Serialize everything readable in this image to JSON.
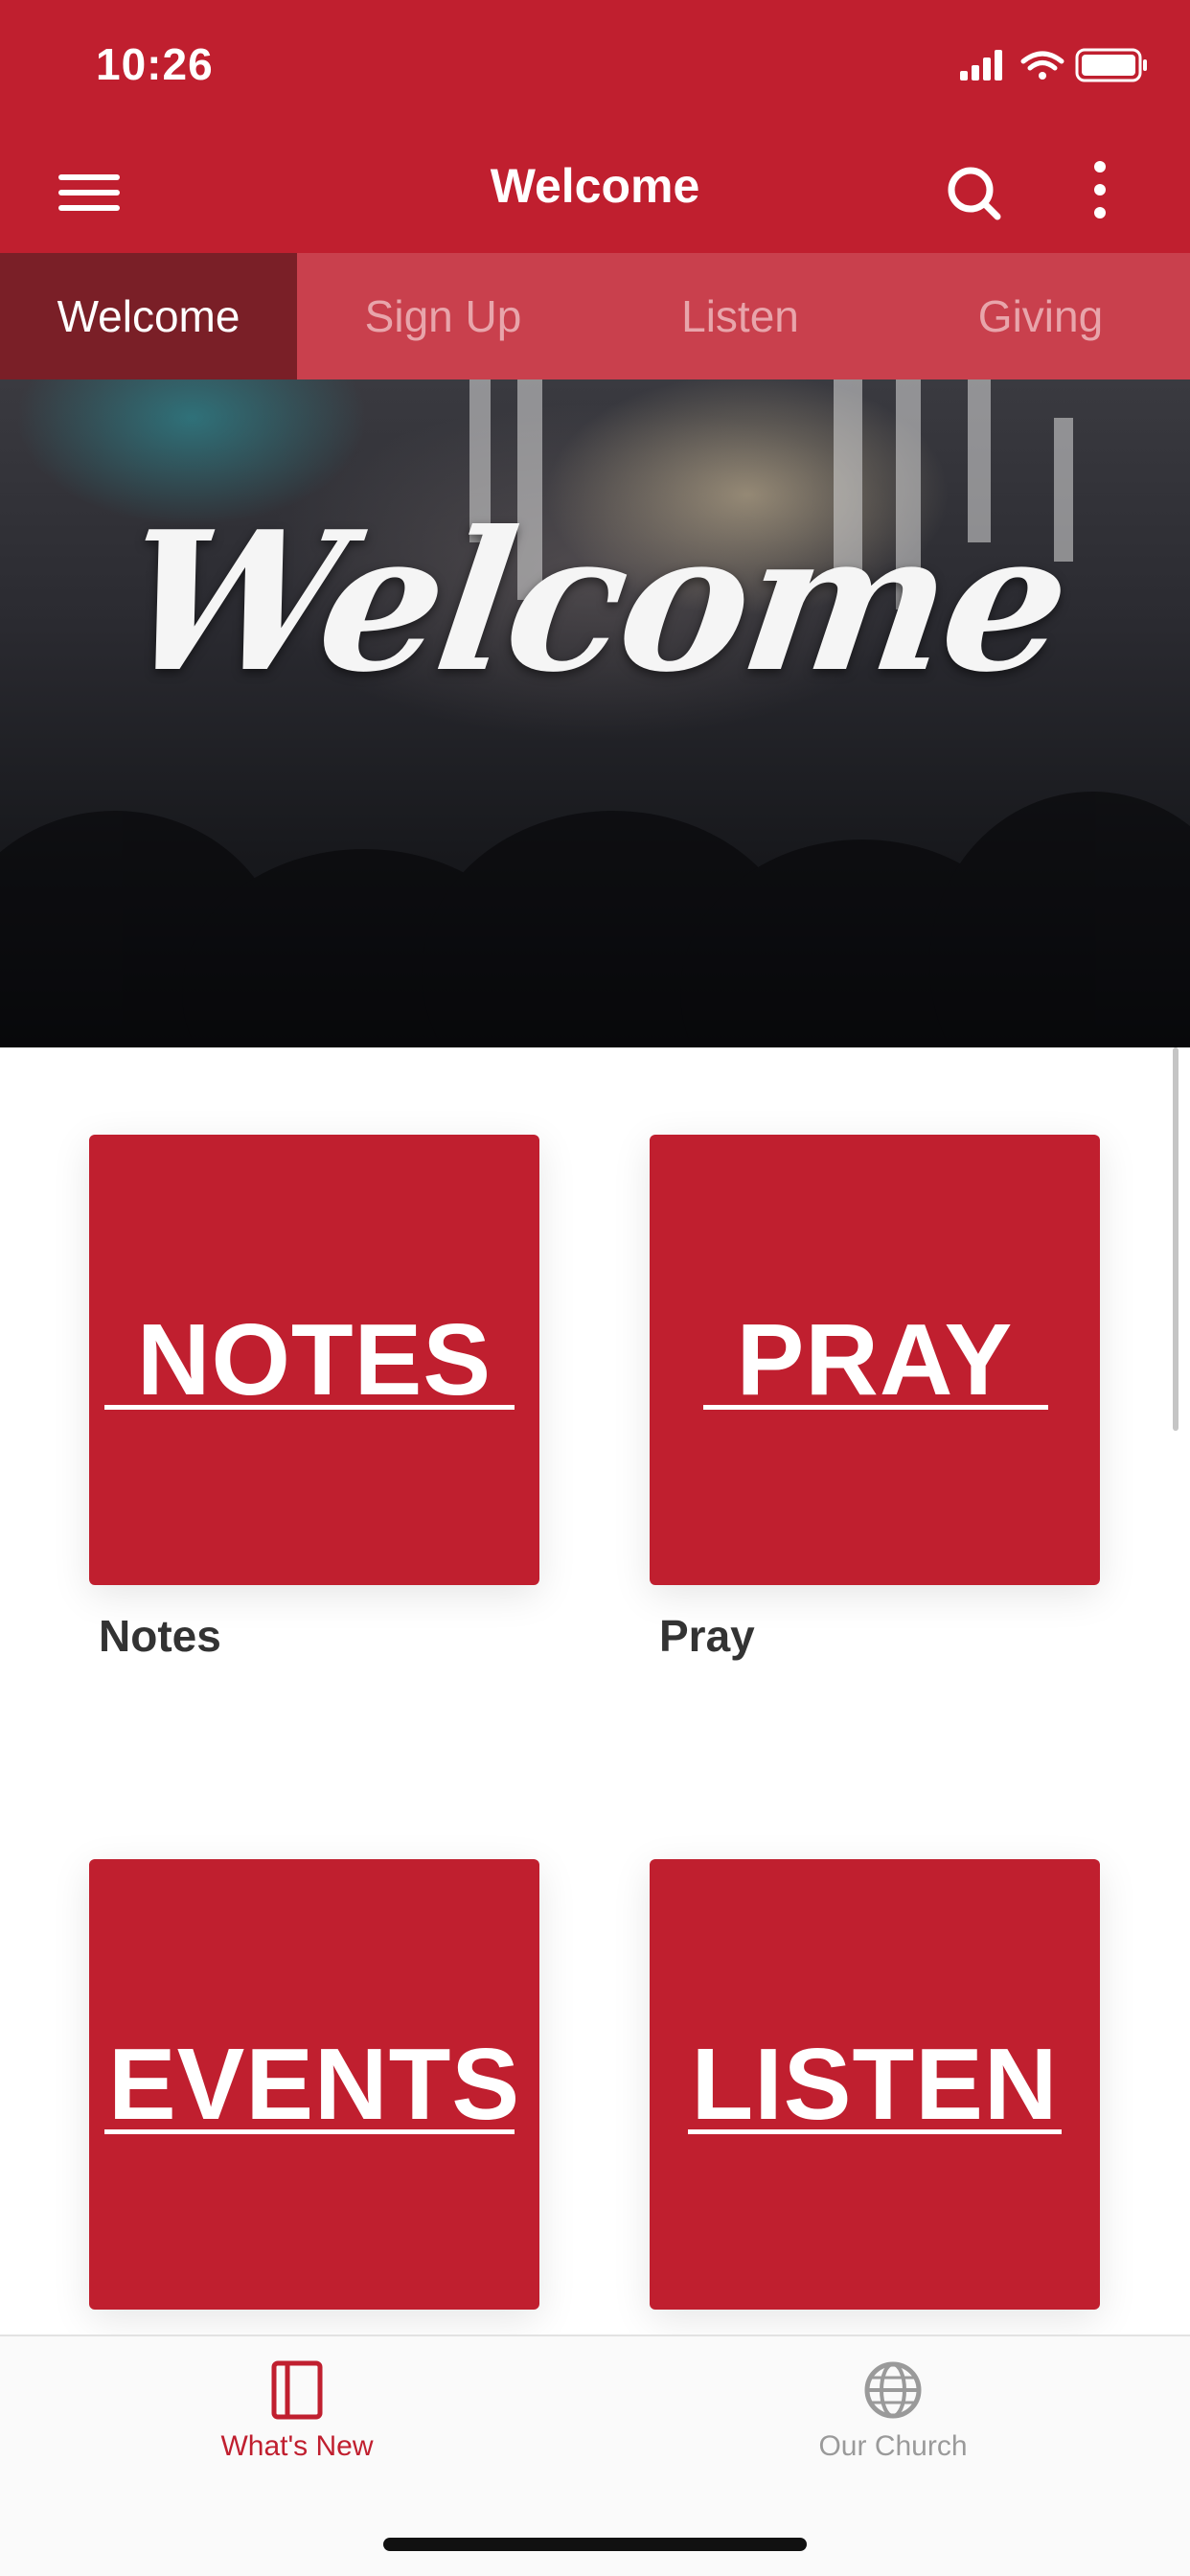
{
  "status_bar": {
    "time": "10:26"
  },
  "nav": {
    "title": "Welcome",
    "menu_icon": "hamburger-menu-icon",
    "search_icon": "search-icon",
    "more_icon": "more-vertical-icon"
  },
  "tabs": [
    {
      "label": "Welcome",
      "active": true
    },
    {
      "label": "Sign Up",
      "active": false
    },
    {
      "label": "Listen",
      "active": false
    },
    {
      "label": "Giving",
      "active": false
    }
  ],
  "hero": {
    "text": "Welcome"
  },
  "tiles": [
    {
      "word": "NOTES",
      "caption": "Notes"
    },
    {
      "word": "PRAY",
      "caption": "Pray"
    },
    {
      "word": "EVENTS",
      "caption": ""
    },
    {
      "word": "LISTEN",
      "caption": ""
    }
  ],
  "bottom_nav": [
    {
      "label": "What's New",
      "icon": "book-icon",
      "active": true
    },
    {
      "label": "Our Church",
      "icon": "globe-icon",
      "active": false
    }
  ],
  "colors": {
    "brand": "#c01f2f",
    "active_tab": "#7a1f27",
    "tab_strip": "#c9404d",
    "inactive": "#9a9a9a"
  }
}
